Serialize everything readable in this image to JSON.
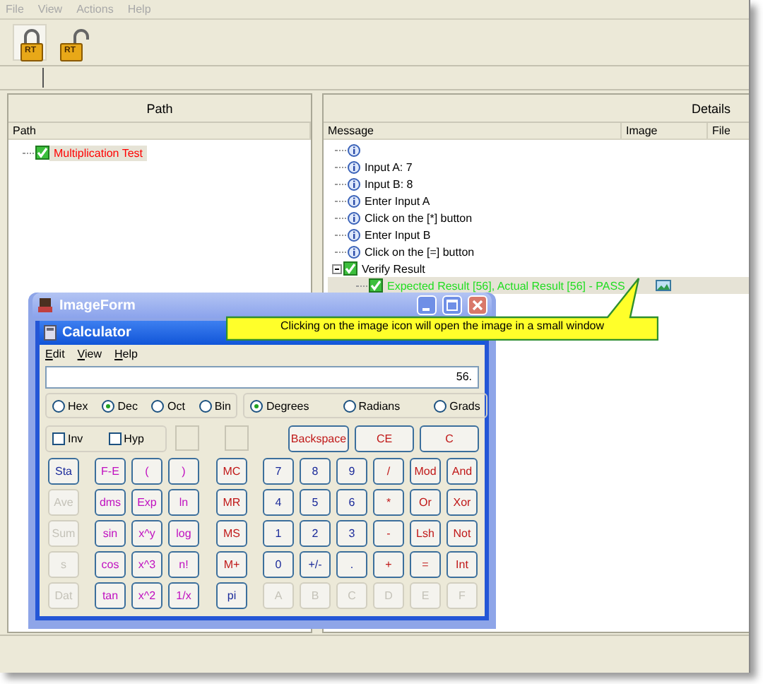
{
  "menu": [
    "File",
    "View",
    "Actions",
    "Help"
  ],
  "toolbar": [
    {
      "label": "RT",
      "kind": "locked"
    },
    {
      "label": "RT",
      "kind": "unlocked"
    }
  ],
  "path_pane": {
    "title": "Path",
    "columns": [
      "Path"
    ],
    "tree": [
      {
        "label": "Multiplication Test",
        "kind": "test",
        "selected": true
      }
    ]
  },
  "details_pane": {
    "title": "Details",
    "columns": [
      "Message",
      "Image",
      "File"
    ],
    "messages": [
      {
        "kind": "info",
        "selected": false
      },
      {
        "kind": "info",
        "text": "Input A: 7",
        "selected": false
      },
      {
        "kind": "info",
        "text": "Input B: 8",
        "selected": false
      },
      {
        "kind": "info",
        "text": "Enter Input A",
        "selected": false
      },
      {
        "kind": "info",
        "text": "Click on the [*] button",
        "selected": false
      },
      {
        "kind": "info",
        "text": "Enter Input B",
        "selected": false
      },
      {
        "kind": "info",
        "text": "Click on the [=] button",
        "selected": false
      },
      {
        "kind": "step",
        "text": "Verify Result",
        "selected": false,
        "expanded": true,
        "children": [
          {
            "kind": "pass",
            "text": "Expected Result [56], Actual Result [56] - PASS",
            "image": true,
            "selected": true
          }
        ]
      }
    ]
  },
  "tooltip": {
    "text": "Clicking on the image icon will open the image in a small window"
  },
  "image_form": {
    "title": "ImageForm",
    "calculator": {
      "title": "Calculator",
      "menu": [
        "Edit",
        "View",
        "Help"
      ],
      "display": "56.",
      "base_options": [
        {
          "label": "Hex",
          "selected": false
        },
        {
          "label": "Dec",
          "selected": true
        },
        {
          "label": "Oct",
          "selected": false
        },
        {
          "label": "Bin",
          "selected": false
        }
      ],
      "angle_options": [
        {
          "label": "Degrees",
          "selected": true
        },
        {
          "label": "Radians",
          "selected": false
        },
        {
          "label": "Grads",
          "selected": false
        }
      ],
      "checkboxes": [
        {
          "label": "Inv",
          "checked": false
        },
        {
          "label": "Hyp",
          "checked": false
        }
      ],
      "edit_buttons": [
        "Backspace",
        "CE",
        "C"
      ],
      "button_groups": [
        [
          [
            {
              "label": "Sta",
              "kind": "stat",
              "disabled": false
            }
          ],
          [
            {
              "label": "Ave",
              "kind": "stat",
              "disabled": true
            }
          ],
          [
            {
              "label": "Sum",
              "kind": "stat",
              "disabled": true
            }
          ],
          [
            {
              "label": "s",
              "kind": "stat",
              "disabled": true
            }
          ],
          [
            {
              "label": "Dat",
              "kind": "stat",
              "disabled": true
            }
          ]
        ],
        [
          [
            {
              "label": "F-E",
              "kind": "sci",
              "disabled": false
            },
            {
              "label": "(",
              "kind": "sci",
              "disabled": false
            },
            {
              "label": ")",
              "kind": "sci",
              "disabled": false
            }
          ],
          [
            {
              "label": "dms",
              "kind": "sci",
              "disabled": false
            },
            {
              "label": "Exp",
              "kind": "sci",
              "disabled": false
            },
            {
              "label": "ln",
              "kind": "sci",
              "disabled": false
            }
          ],
          [
            {
              "label": "sin",
              "kind": "sci",
              "disabled": false
            },
            {
              "label": "x^y",
              "kind": "sci",
              "disabled": false
            },
            {
              "label": "log",
              "kind": "sci",
              "disabled": false
            }
          ],
          [
            {
              "label": "cos",
              "kind": "sci",
              "disabled": false
            },
            {
              "label": "x^3",
              "kind": "sci",
              "disabled": false
            },
            {
              "label": "n!",
              "kind": "sci",
              "disabled": false
            }
          ],
          [
            {
              "label": "tan",
              "kind": "sci",
              "disabled": false
            },
            {
              "label": "x^2",
              "kind": "sci",
              "disabled": false
            },
            {
              "label": "1/x",
              "kind": "sci",
              "disabled": false
            }
          ]
        ],
        [
          [
            {
              "label": "MC",
              "kind": "mem",
              "disabled": false
            }
          ],
          [
            {
              "label": "MR",
              "kind": "mem",
              "disabled": false
            }
          ],
          [
            {
              "label": "MS",
              "kind": "mem",
              "disabled": false
            }
          ],
          [
            {
              "label": "M+",
              "kind": "mem",
              "disabled": false
            }
          ],
          [
            {
              "label": "pi",
              "kind": "const",
              "disabled": false
            }
          ]
        ],
        [
          [
            {
              "label": "7",
              "kind": "digit",
              "disabled": false
            },
            {
              "label": "8",
              "kind": "digit",
              "disabled": false
            },
            {
              "label": "9",
              "kind": "digit",
              "disabled": false
            },
            {
              "label": "/",
              "kind": "op",
              "disabled": false
            },
            {
              "label": "Mod",
              "kind": "op",
              "disabled": false
            },
            {
              "label": "And",
              "kind": "op",
              "disabled": false
            }
          ],
          [
            {
              "label": "4",
              "kind": "digit",
              "disabled": false
            },
            {
              "label": "5",
              "kind": "digit",
              "disabled": false
            },
            {
              "label": "6",
              "kind": "digit",
              "disabled": false
            },
            {
              "label": "*",
              "kind": "op",
              "disabled": false
            },
            {
              "label": "Or",
              "kind": "op",
              "disabled": false
            },
            {
              "label": "Xor",
              "kind": "op",
              "disabled": false
            }
          ],
          [
            {
              "label": "1",
              "kind": "digit",
              "disabled": false
            },
            {
              "label": "2",
              "kind": "digit",
              "disabled": false
            },
            {
              "label": "3",
              "kind": "digit",
              "disabled": false
            },
            {
              "label": "-",
              "kind": "op",
              "disabled": false
            },
            {
              "label": "Lsh",
              "kind": "op",
              "disabled": false
            },
            {
              "label": "Not",
              "kind": "op",
              "disabled": false
            }
          ],
          [
            {
              "label": "0",
              "kind": "digit",
              "disabled": false
            },
            {
              "label": "+/-",
              "kind": "digit",
              "disabled": false
            },
            {
              "label": ".",
              "kind": "digit",
              "disabled": false
            },
            {
              "label": "+",
              "kind": "op",
              "disabled": false
            },
            {
              "label": "=",
              "kind": "op",
              "disabled": false
            },
            {
              "label": "Int",
              "kind": "op",
              "disabled": false
            }
          ],
          [
            {
              "label": "A",
              "kind": "digit",
              "disabled": true
            },
            {
              "label": "B",
              "kind": "digit",
              "disabled": true
            },
            {
              "label": "C",
              "kind": "digit",
              "disabled": true
            },
            {
              "label": "D",
              "kind": "digit",
              "disabled": true
            },
            {
              "label": "E",
              "kind": "digit",
              "disabled": true
            },
            {
              "label": "F",
              "kind": "digit",
              "disabled": true
            }
          ]
        ]
      ]
    }
  }
}
